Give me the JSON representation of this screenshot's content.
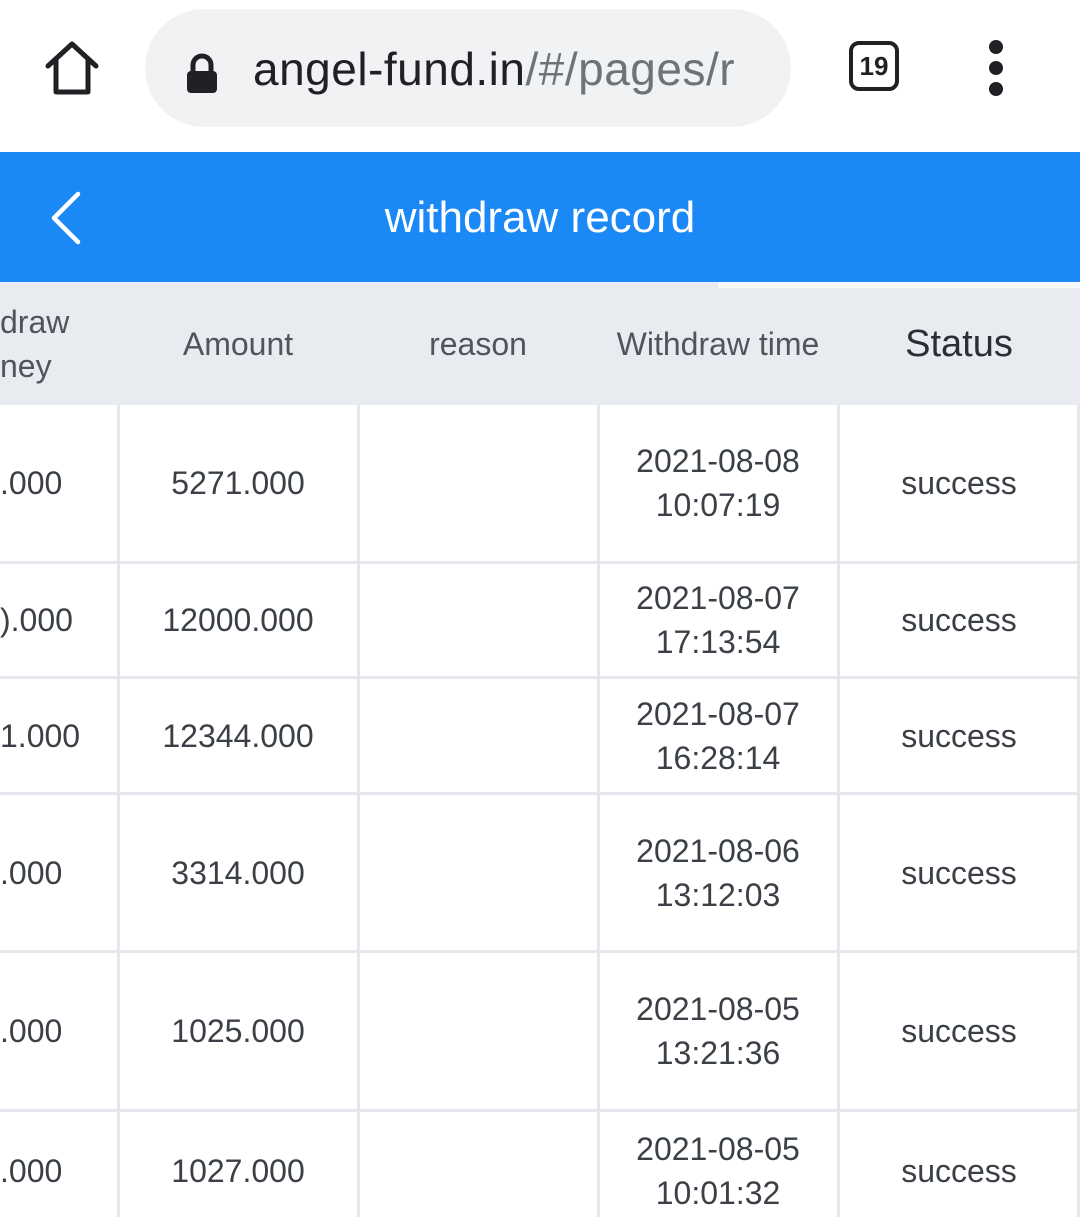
{
  "browser": {
    "url_host": "angel-fund.in",
    "url_path": "/#/pages/r",
    "tab_count": "19",
    "icons": [
      "home-icon",
      "lock-icon",
      "tabs-icon",
      "more-vertical-icon"
    ]
  },
  "header": {
    "title": "withdraw record",
    "back_icon": "chevron-left-icon",
    "color": "#1a88f5"
  },
  "table": {
    "columns": {
      "money_line1": "draw",
      "money_line2": "ney",
      "amount": "Amount",
      "reason": "reason",
      "time": "Withdraw time",
      "status": "Status"
    },
    "rows": [
      {
        "money": ".000",
        "amount": "5271.000",
        "reason": "",
        "date": "2021-08-08",
        "time": "10:07:19",
        "status": "success"
      },
      {
        "money": ").000",
        "amount": "12000.000",
        "reason": "",
        "date": "2021-08-07",
        "time": "17:13:54",
        "status": "success"
      },
      {
        "money": "1.000",
        "amount": "12344.000",
        "reason": "",
        "date": "2021-08-07",
        "time": "16:28:14",
        "status": "success"
      },
      {
        "money": ".000",
        "amount": "3314.000",
        "reason": "",
        "date": "2021-08-06",
        "time": "13:12:03",
        "status": "success"
      },
      {
        "money": ".000",
        "amount": "1025.000",
        "reason": "",
        "date": "2021-08-05",
        "time": "13:21:36",
        "status": "success"
      },
      {
        "money": ".000",
        "amount": "1027.000",
        "reason": "",
        "date": "2021-08-05",
        "time": "10:01:32",
        "status": "success"
      }
    ]
  }
}
